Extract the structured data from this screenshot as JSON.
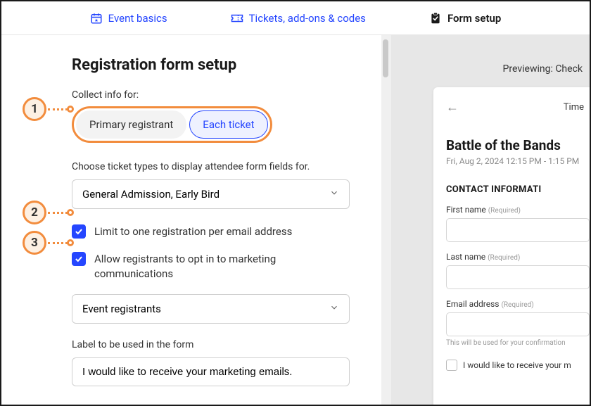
{
  "tabs": {
    "basics": "Event basics",
    "tickets": "Tickets, add-ons & codes",
    "form": "Form setup"
  },
  "main": {
    "title": "Registration form setup",
    "collect_label": "Collect info for:",
    "seg": {
      "primary": "Primary registrant",
      "each": "Each ticket"
    },
    "ticket_types_label": "Choose ticket types to display attendee form fields for.",
    "ticket_types_value": "General Admission, Early Bird",
    "limit_label": "Limit to one registration per email address",
    "optin_label": "Allow registrants to opt in to marketing communications",
    "audience_select": "Event registrants",
    "form_label_caption": "Label to be used in the form",
    "form_label_value": "I would like to receive your marketing emails."
  },
  "markers": {
    "one": "1",
    "two": "2",
    "three": "3"
  },
  "preview": {
    "header": "Previewing: Check",
    "timer": "Time",
    "event_title": "Battle of the Bands",
    "event_date": "Fri, Aug 2, 2024 12:15 PM - 1:15 PM",
    "section": "CONTACT INFORMATI",
    "first_name": "First name",
    "last_name": "Last name",
    "email": "Email address",
    "required": "(Required)",
    "email_hint": "This will be used for your confirmation",
    "optin_text": "I would like to receive your m"
  }
}
